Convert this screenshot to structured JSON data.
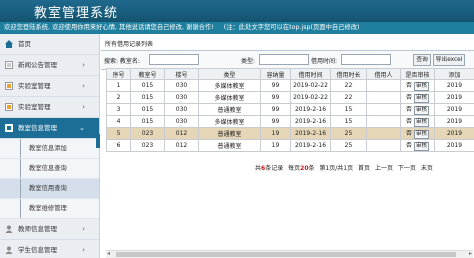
{
  "app": {
    "title": "教室管理系统",
    "banner_welcome": "欢迎您登陆系统, 欢迎使用你用来好心情, 其他说话请您自己修改, 谢谢合作!",
    "banner_note": "(注：此处文字您可以在top.jsp(页面中自己修改)"
  },
  "sidebar": {
    "items": [
      {
        "label": "首页",
        "icon": "home-icon"
      },
      {
        "label": "新闻公告管理",
        "icon": "news-icon"
      },
      {
        "label": "实验室管理",
        "icon": "lab-icon"
      },
      {
        "label": "实验室管理",
        "icon": "lab-icon"
      },
      {
        "label": "教室信息管理",
        "icon": "classroom-icon"
      },
      {
        "label": "教师信息管理",
        "icon": "teacher-icon"
      },
      {
        "label": "学生信息管理",
        "icon": "student-icon"
      }
    ],
    "subitems": [
      {
        "label": "教室信息添加"
      },
      {
        "label": "教室信息查询"
      },
      {
        "label": "教室信用查询"
      },
      {
        "label": "教室维修管理"
      }
    ]
  },
  "panel": {
    "title": "所有借用记录列表"
  },
  "search": {
    "label_room": "搜索: 教室名:",
    "label_type": "类型:",
    "label_date": "借用时间:",
    "search_button": "查询",
    "export_button": "导出excel"
  },
  "table": {
    "headers": [
      "序号",
      "教室号",
      "楼号",
      "类型",
      "容纳量",
      "借用时间",
      "借用时长",
      "借用人",
      "是否审核",
      "添加"
    ],
    "rows": [
      [
        "1",
        "015",
        "030",
        "多媒体教室",
        "99",
        "2019-02-22",
        "22",
        "",
        "否",
        "审核",
        "2019"
      ],
      [
        "2",
        "015",
        "030",
        "多媒体教室",
        "99",
        "2019-02-22",
        "22",
        "",
        "否",
        "审核",
        "2019"
      ],
      [
        "3",
        "015",
        "030",
        "普通教室",
        "99",
        "2019-2-16",
        "15",
        "",
        "否",
        "审核",
        "2019"
      ],
      [
        "4",
        "015",
        "030",
        "多媒体教室",
        "99",
        "2019-2-16",
        "15",
        "",
        "否",
        "审核",
        "2019"
      ],
      [
        "5",
        "023",
        "012",
        "普通教室",
        "19",
        "2019-2-16",
        "25",
        "",
        "否",
        "审核",
        "2019"
      ],
      [
        "6",
        "023",
        "012",
        "普通教室",
        "19",
        "2019-2-16",
        "25",
        "",
        "否",
        "审核",
        "2019"
      ]
    ]
  },
  "pager": {
    "total_pre": "共",
    "total": "6",
    "total_post": "条记录",
    "per_pre": "每页",
    "per": "20",
    "per_post": "条",
    "page_info": "第1页/共1页",
    "first": "首页",
    "prev": "上一页",
    "next": "下一页",
    "last": "末页"
  },
  "colors": {
    "header": "#1f6a8e",
    "banner": "#1f7f9f",
    "active_item": "#1c6e96",
    "selected_row": "#e6d6b8",
    "pager_red": "#d01818"
  }
}
